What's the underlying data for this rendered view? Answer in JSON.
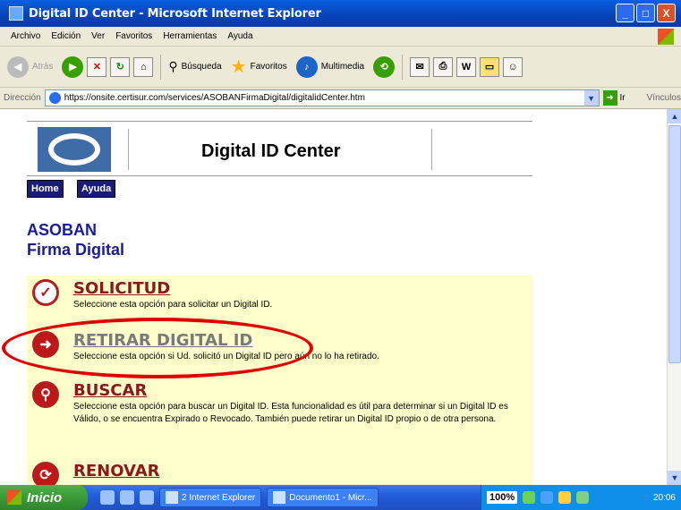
{
  "window": {
    "title": "Digital ID Center - Microsoft Internet Explorer",
    "controls": [
      "_",
      "□",
      "X"
    ]
  },
  "menu": [
    "Archivo",
    "Edición",
    "Ver",
    "Favoritos",
    "Herramientas",
    "Ayuda"
  ],
  "toolbar": {
    "back": "Atrás",
    "search": "Búsqueda",
    "favorites": "Favoritos",
    "multimedia": "Multimedia"
  },
  "address": {
    "label": "Dirección",
    "url": "https://onsite.certisur.com/services/ASOBANFirmaDigital/digitalidCenter.htm",
    "go": "Ir",
    "links": "Vínculos"
  },
  "page": {
    "header_title": "Digital ID Center",
    "nav": {
      "home": "Home",
      "help": "Ayuda"
    },
    "org_line1": "ASOBAN",
    "org_line2": "Firma Digital",
    "options": [
      {
        "name": "SOLICITUD",
        "desc": "Seleccione esta opción para solicitar un Digital ID."
      },
      {
        "name": "RETIRAR DIGITAL ID",
        "desc": "Seleccione esta opción si Ud. solicitó un Digital ID pero aún no lo ha retirado."
      },
      {
        "name": "BUSCAR",
        "desc": "Seleccione esta opción para buscar un Digital ID. Esta funcionalidad es útil para determinar si un Digital ID es Válido, o se encuentra Expirado o Revocado. También puede retirar un Digital ID propio o de otra persona."
      },
      {
        "name": "RENOVAR",
        "desc": ""
      }
    ]
  },
  "taskbar": {
    "start": "Inicio",
    "tasks": [
      "2 Internet Explorer",
      "Documento1 - Micr..."
    ],
    "zoom": "100%",
    "clock": "20:06"
  },
  "colors": {
    "option_bg": "#ffffcc",
    "option_title": "#8a1a1a",
    "org_text": "#1a1a9a",
    "highlight": "#e00000"
  }
}
